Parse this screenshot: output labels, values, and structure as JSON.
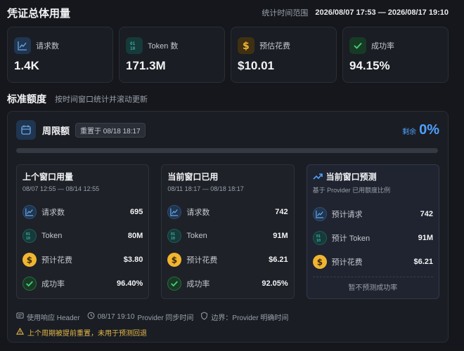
{
  "header": {
    "title": "凭证总体用量",
    "range_label": "统计时间范围",
    "range_value": "2026/08/07 17:53 — 2026/08/17 19:10"
  },
  "cards": [
    {
      "label": "请求数",
      "value": "1.4K",
      "icon": "chart-line-icon"
    },
    {
      "label": "Token 数",
      "value": "171.3M",
      "icon": "binary-icon"
    },
    {
      "label": "预估花费",
      "value": "$10.01",
      "icon": "dollar-icon"
    },
    {
      "label": "成功率",
      "value": "94.15%",
      "icon": "check-icon"
    }
  ],
  "section": {
    "title": "标准额度",
    "subtitle": "按时间窗口统计并滚动更新"
  },
  "quota": {
    "name": "周限额",
    "reset": "重置于 08/18 18:17",
    "remaining_label": "剩余",
    "remaining_value": "0%",
    "used_fraction": 1.0,
    "colors": {
      "accent": "#4ea1ff",
      "warning": "#e5b94a",
      "amber": "#f2b531"
    }
  },
  "columns": [
    {
      "title": "上个窗口用量",
      "subtitle": "08/07 12:55 — 08/14 12:55",
      "rows": [
        {
          "label": "请求数",
          "value": "695"
        },
        {
          "label": "Token",
          "value": "80M"
        },
        {
          "label": "预计花费",
          "value": "$3.80"
        },
        {
          "label": "成功率",
          "value": "96.40%"
        }
      ]
    },
    {
      "title": "当前窗口已用",
      "subtitle": "08/11 18:17 — 08/18 18:17",
      "rows": [
        {
          "label": "请求数",
          "value": "742"
        },
        {
          "label": "Token",
          "value": "91M"
        },
        {
          "label": "预计花费",
          "value": "$6.21"
        },
        {
          "label": "成功率",
          "value": "92.05%"
        }
      ]
    },
    {
      "title": "当前窗口预测",
      "subtitle": "基于 Provider 已用额度比例",
      "rows": [
        {
          "label": "预计请求",
          "value": "742"
        },
        {
          "label": "预计 Token",
          "value": "91M"
        },
        {
          "label": "预计花费",
          "value": "$6.21"
        }
      ],
      "note": "暂不预测成功率"
    }
  ],
  "footer": {
    "source": "使用响应 Header",
    "sync_time": "08/17 19:10",
    "sync_label": "Provider 同步时间",
    "boundary": "边界：Provider 明确时间",
    "warning": "上个周期被提前重置，未用于预测回退"
  }
}
